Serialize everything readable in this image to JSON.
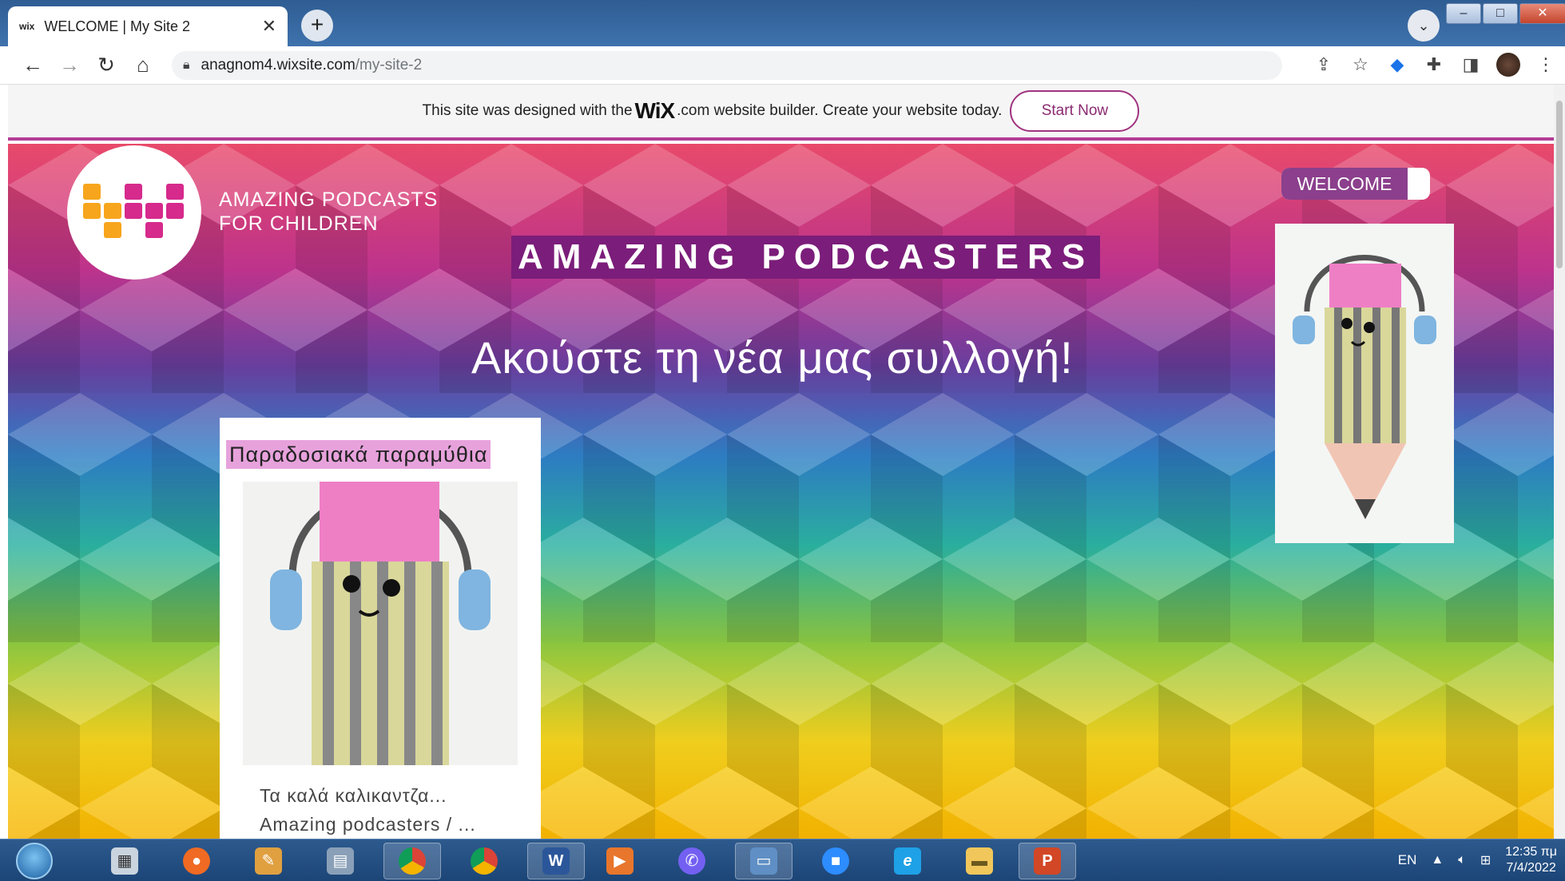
{
  "browser": {
    "tab": {
      "favicon": "wix",
      "title": "WELCOME | My Site 2"
    },
    "address": {
      "domain": "anagnom4.wixsite.com",
      "path": "/my-site-2"
    }
  },
  "wix_banner": {
    "text_before": "This site was designed with the",
    "logo": "WiX",
    "text_after": ".com website builder. Create your website today.",
    "button": "Start Now"
  },
  "site": {
    "logo_text_line1": "AMAZING PODCASTS",
    "logo_text_line2": "FOR CHILDREN",
    "heading": "AMAZING PODCASTERS",
    "subheading": "Ακούστε τη νέα μας συλλογή!",
    "nav_welcome": "WELCOME",
    "story_card": {
      "title": "Παραδοσιακά παραμύθια",
      "caption_line1": "Τα καλά καλικαντζα...",
      "caption_line2": "Amazing podcasters / ..."
    }
  },
  "taskbar": {
    "language": "EN",
    "time": "12:35 πμ",
    "date": "7/4/2022"
  },
  "colors": {
    "accent": "#b43c96",
    "heading_bg": "#7b1d7a",
    "story_title_bg": "#e7a2dc",
    "welcome_bg": "#8b3f8c"
  }
}
